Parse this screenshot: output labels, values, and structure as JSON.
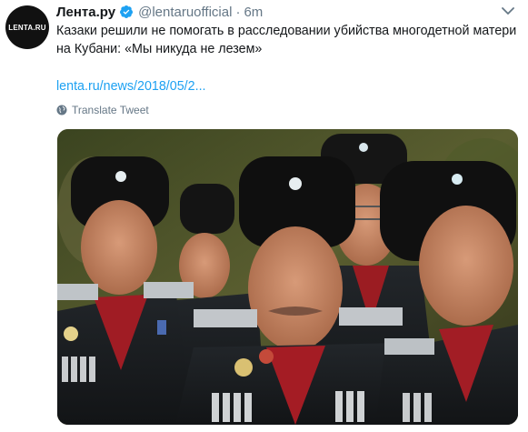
{
  "account": {
    "avatar_text": "LENTA.RU",
    "display_name": "Лента.ру",
    "handle": "@lentaruofficial",
    "separator": "·",
    "time": "6m"
  },
  "tweet": {
    "text": "Казаки решили не помогать в расследовании убийства многодетной матери на Кубани: «Мы никуда не лезем»",
    "link": "lenta.ru/news/2018/05/2...",
    "translate_label": "Translate Tweet"
  },
  "colors": {
    "link": "#1da1f2",
    "secondary_text": "#657786",
    "verified": "#1da1f2"
  },
  "icons": {
    "verified": "verified-badge-icon",
    "caret": "chevron-down-icon",
    "translate": "globe-icon"
  }
}
